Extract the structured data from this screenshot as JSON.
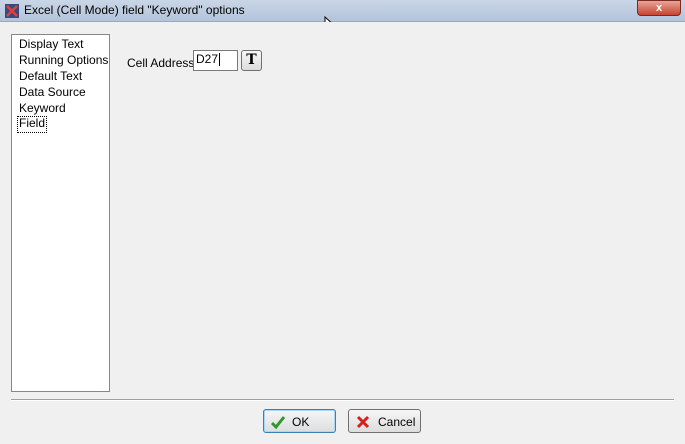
{
  "window": {
    "title": "Excel (Cell Mode) field \"Keyword\" options",
    "close_label": "x"
  },
  "sidebar": {
    "items": [
      {
        "label": "Display Text"
      },
      {
        "label": "Running Options"
      },
      {
        "label": "Default Text"
      },
      {
        "label": "Data Source"
      },
      {
        "label": "Keyword"
      },
      {
        "label": "Field"
      }
    ],
    "selected": "Field"
  },
  "main": {
    "cell_address_label": "Cell Address",
    "cell_address_value": "D27",
    "text_button_label": "T"
  },
  "footer": {
    "ok_label": "OK",
    "cancel_label": "Cancel"
  },
  "colors": {
    "ok_check": "#2e9a2e",
    "cancel_x": "#d62020"
  }
}
